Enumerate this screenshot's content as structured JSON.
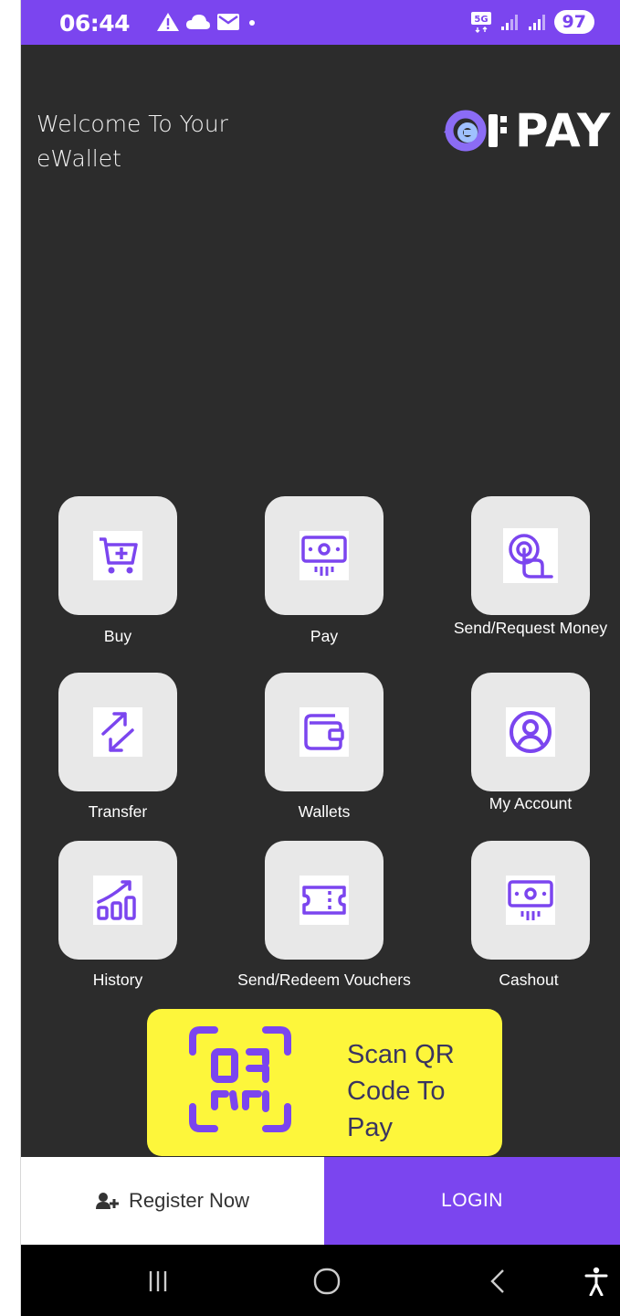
{
  "status_bar": {
    "time": "06:44",
    "battery": "97",
    "network": "5G"
  },
  "header": {
    "welcome": "Welcome To Your eWallet",
    "logo_text": "PAY"
  },
  "tiles": [
    {
      "label": "Buy",
      "icon": "cart-plus-icon"
    },
    {
      "label": "Pay",
      "icon": "cash-icon"
    },
    {
      "label": "Send/Request Money",
      "icon": "tap-coin-icon"
    },
    {
      "label": "Transfer",
      "icon": "transfer-arrows-icon"
    },
    {
      "label": "Wallets",
      "icon": "wallet-icon"
    },
    {
      "label": "My Account",
      "icon": "user-circle-icon"
    },
    {
      "label": "History",
      "icon": "growth-chart-icon"
    },
    {
      "label": "Send/Redeem Vouchers",
      "icon": "voucher-ticket-icon"
    },
    {
      "label": "Cashout",
      "icon": "cash-icon"
    }
  ],
  "qr_card": {
    "label": "Scan QR Code To Pay",
    "icon": "qr-scan-icon"
  },
  "bottom": {
    "register_label": "Register Now",
    "login_label": "LOGIN"
  },
  "colors": {
    "accent": "#7b45ef",
    "background": "#2c2c2c",
    "tile": "#e8e8e8",
    "qr_card": "#fdf63b"
  }
}
